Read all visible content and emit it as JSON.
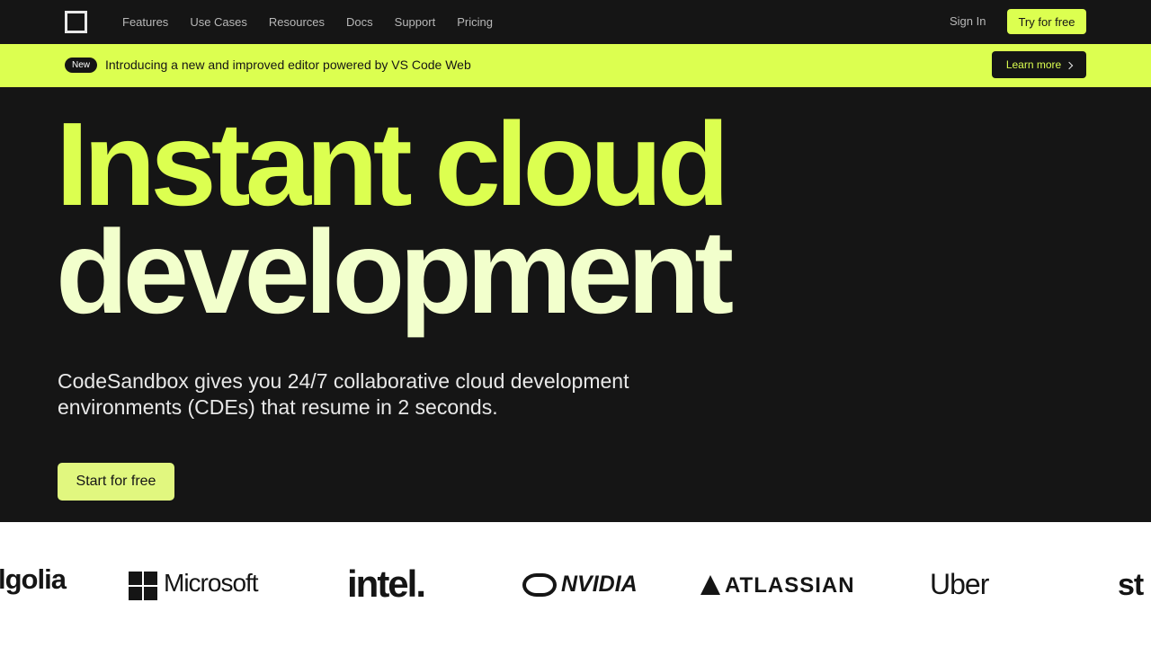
{
  "nav": {
    "links": [
      "Features",
      "Use Cases",
      "Resources",
      "Docs",
      "Support",
      "Pricing"
    ],
    "sign_in": "Sign In",
    "try_free": "Try for free"
  },
  "banner": {
    "badge": "New",
    "text": "Introducing a new and improved editor powered by VS Code Web",
    "button": "Learn more"
  },
  "hero": {
    "line1": "Instant cloud",
    "line2": "development",
    "subtitle": "CodeSandbox gives you 24/7 collaborative cloud development environments (CDEs) that resume in 2 seconds.",
    "cta": "Start for free"
  },
  "logos": [
    "lgolia",
    "Microsoft",
    "intel.",
    "NVIDIA",
    "ATLASSIAN",
    "Uber",
    "st"
  ],
  "colors": {
    "background": "#151515",
    "accent": "#dcff50",
    "accent_light": "#f2ffcc"
  }
}
